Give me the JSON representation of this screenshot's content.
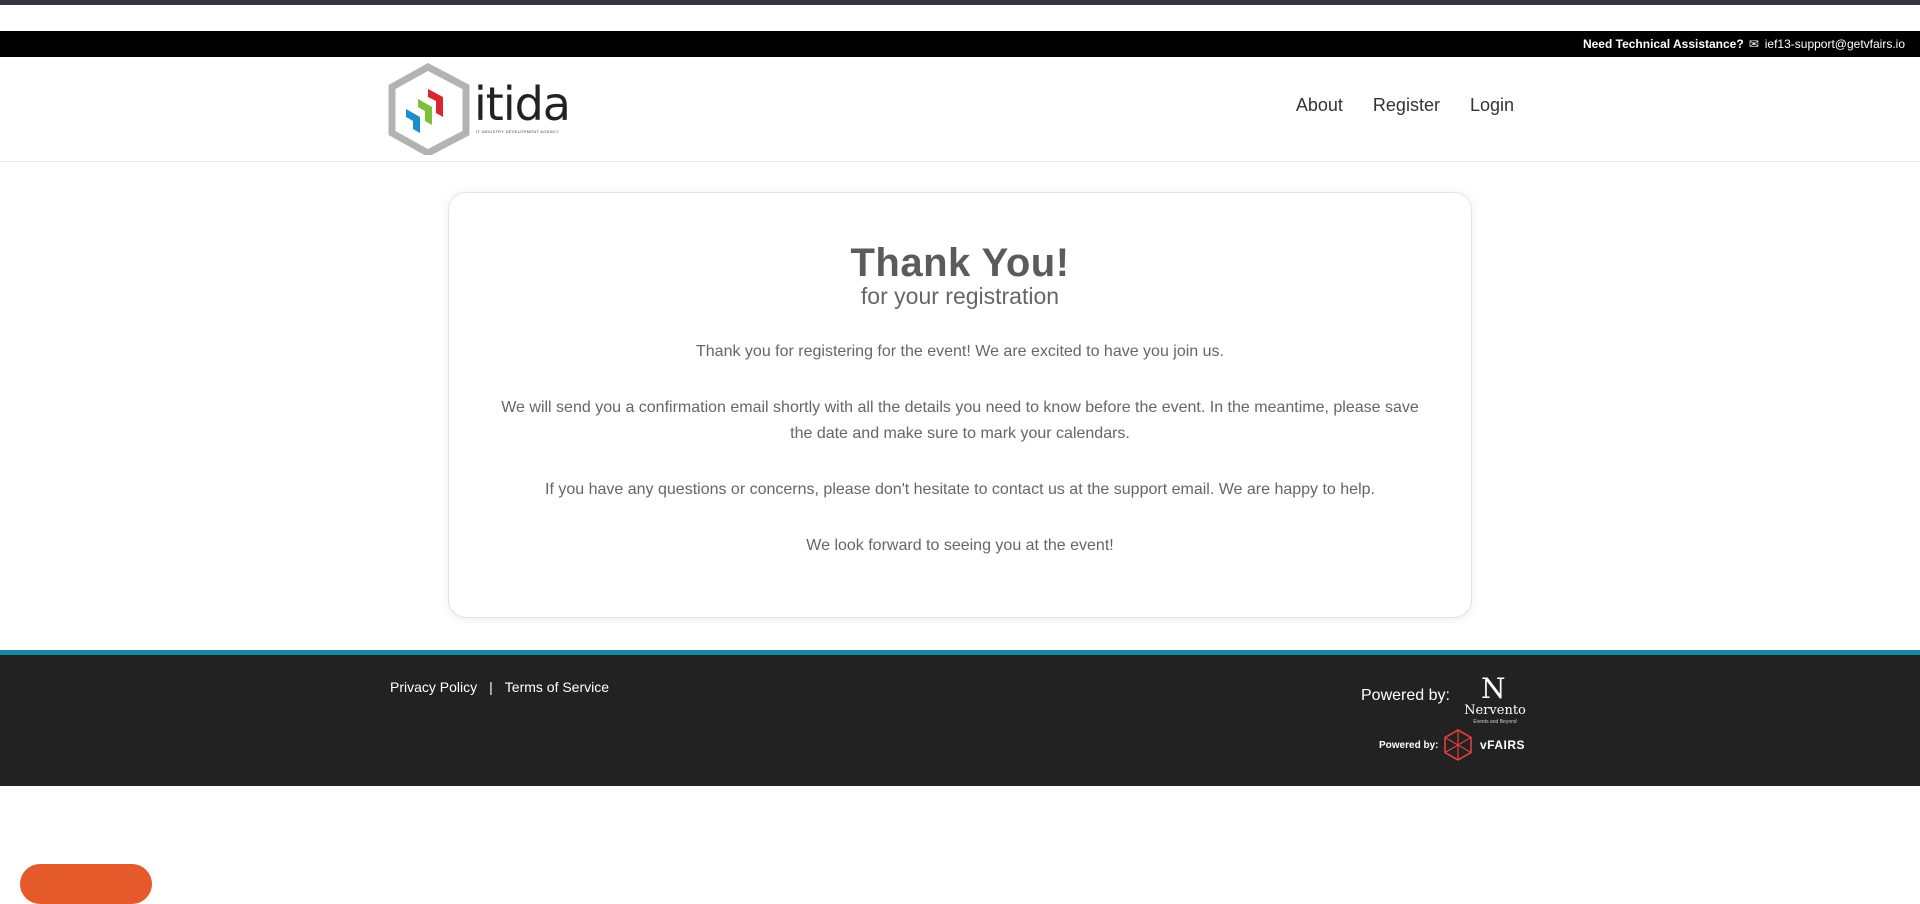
{
  "support_bar": {
    "label": "Need Technical Assistance?",
    "mail_icon": "✉",
    "email": "ief13-support@getvfairs.io"
  },
  "logo": {
    "wordmark": "itida",
    "tagline": "IT INDUSTRY DEVELOPMENT AGENCY"
  },
  "nav": {
    "items": [
      "About",
      "Register",
      "Login"
    ]
  },
  "card": {
    "title": "Thank You!",
    "subtitle": "for your registration",
    "paragraphs": [
      "Thank you for registering for the event! We are excited to have you join us.",
      "We will send you a confirmation email shortly with all the details you need to know before the event. In the meantime, please save the date and make sure to mark your calendars.",
      "If you have any questions or concerns, please don't hesitate to contact us at the support email. We are happy to help.",
      "We look forward to seeing you at the event!"
    ]
  },
  "footer": {
    "links": [
      "Privacy Policy",
      "Terms of Service"
    ],
    "separator": "|",
    "powered_by_1": "Powered by:",
    "nervento": {
      "mark": "N",
      "name": "Nervento",
      "tag": "Events and Beyond"
    },
    "powered_by_2": "Powered by:",
    "vfairs": "vFAIRS"
  },
  "colors": {
    "support_bar": "#000000",
    "footer": "#222222",
    "footer_accent": "#1a86a8",
    "chat_button": "#e55a2b",
    "logo_red": "#d9252b",
    "logo_green": "#7cbf3a",
    "logo_blue": "#1c8fc8",
    "logo_grey": "#b3b3b3"
  }
}
